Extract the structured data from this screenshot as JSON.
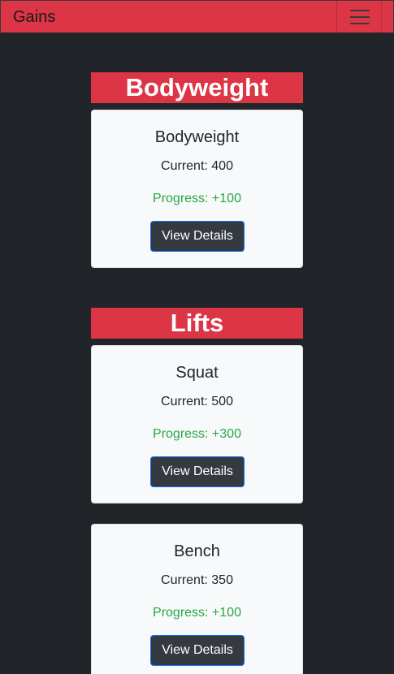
{
  "navbar": {
    "brand": "Gains",
    "toggle_icon": "hamburger-menu-icon"
  },
  "sections": {
    "bodyweight": {
      "heading": "Bodyweight",
      "cards": [
        {
          "title": "Bodyweight",
          "current": "Current: 400",
          "progress": "Progress: +100",
          "button": "View Details"
        }
      ]
    },
    "lifts": {
      "heading": "Lifts",
      "cards": [
        {
          "title": "Squat",
          "current": "Current: 500",
          "progress": "Progress: +300",
          "button": "View Details"
        },
        {
          "title": "Bench",
          "current": "Current: 350",
          "progress": "Progress: +100",
          "button": "View Details"
        }
      ]
    }
  },
  "colors": {
    "background": "#212529",
    "accent": "#dc3545",
    "card": "#f8f9fa",
    "progress": "#28a745",
    "button": "#343a40"
  }
}
